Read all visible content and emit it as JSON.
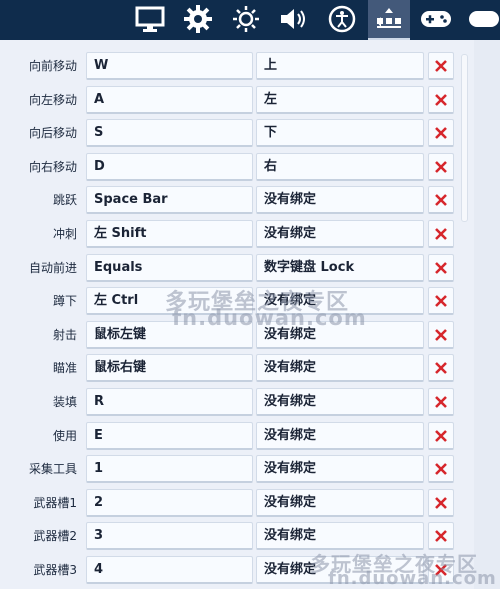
{
  "nav": {
    "tabs": [
      {
        "icon": "monitor-icon",
        "active": false
      },
      {
        "icon": "gear-icon",
        "active": false
      },
      {
        "icon": "brightness-icon",
        "active": false
      },
      {
        "icon": "speaker-icon",
        "active": false
      },
      {
        "icon": "accessibility-icon",
        "active": false
      },
      {
        "icon": "controls-icon",
        "active": true
      },
      {
        "icon": "gamepad-icon",
        "active": false
      }
    ]
  },
  "keybinds": [
    {
      "action": "向前移动",
      "primary": "W",
      "secondary": "上"
    },
    {
      "action": "向左移动",
      "primary": "A",
      "secondary": "左"
    },
    {
      "action": "向后移动",
      "primary": "S",
      "secondary": "下"
    },
    {
      "action": "向右移动",
      "primary": "D",
      "secondary": "右"
    },
    {
      "action": "跳跃",
      "primary": "Space Bar",
      "secondary": "没有绑定"
    },
    {
      "action": "冲刺",
      "primary": "左 Shift",
      "secondary": "没有绑定"
    },
    {
      "action": "自动前进",
      "primary": "Equals",
      "secondary": "数字键盘 Lock"
    },
    {
      "action": "蹲下",
      "primary": "左 Ctrl",
      "secondary": "没有绑定"
    },
    {
      "action": "射击",
      "primary": "鼠标左键",
      "secondary": "没有绑定"
    },
    {
      "action": "瞄准",
      "primary": "鼠标右键",
      "secondary": "没有绑定"
    },
    {
      "action": "装填",
      "primary": "R",
      "secondary": "没有绑定"
    },
    {
      "action": "使用",
      "primary": "E",
      "secondary": "没有绑定"
    },
    {
      "action": "采集工具",
      "primary": "1",
      "secondary": "没有绑定"
    },
    {
      "action": "武器槽1",
      "primary": "2",
      "secondary": "没有绑定"
    },
    {
      "action": "武器槽2",
      "primary": "3",
      "secondary": "没有绑定"
    },
    {
      "action": "武器槽3",
      "primary": "4",
      "secondary": "没有绑定"
    }
  ],
  "watermark": {
    "line1": "多玩堡垒之夜专区",
    "line2": "fn.duowan.com"
  },
  "colors": {
    "topbar": "#0f2c4c",
    "active_tab": "#43597a",
    "background": "#ecf0f8",
    "clear_x": "#d6262c"
  }
}
